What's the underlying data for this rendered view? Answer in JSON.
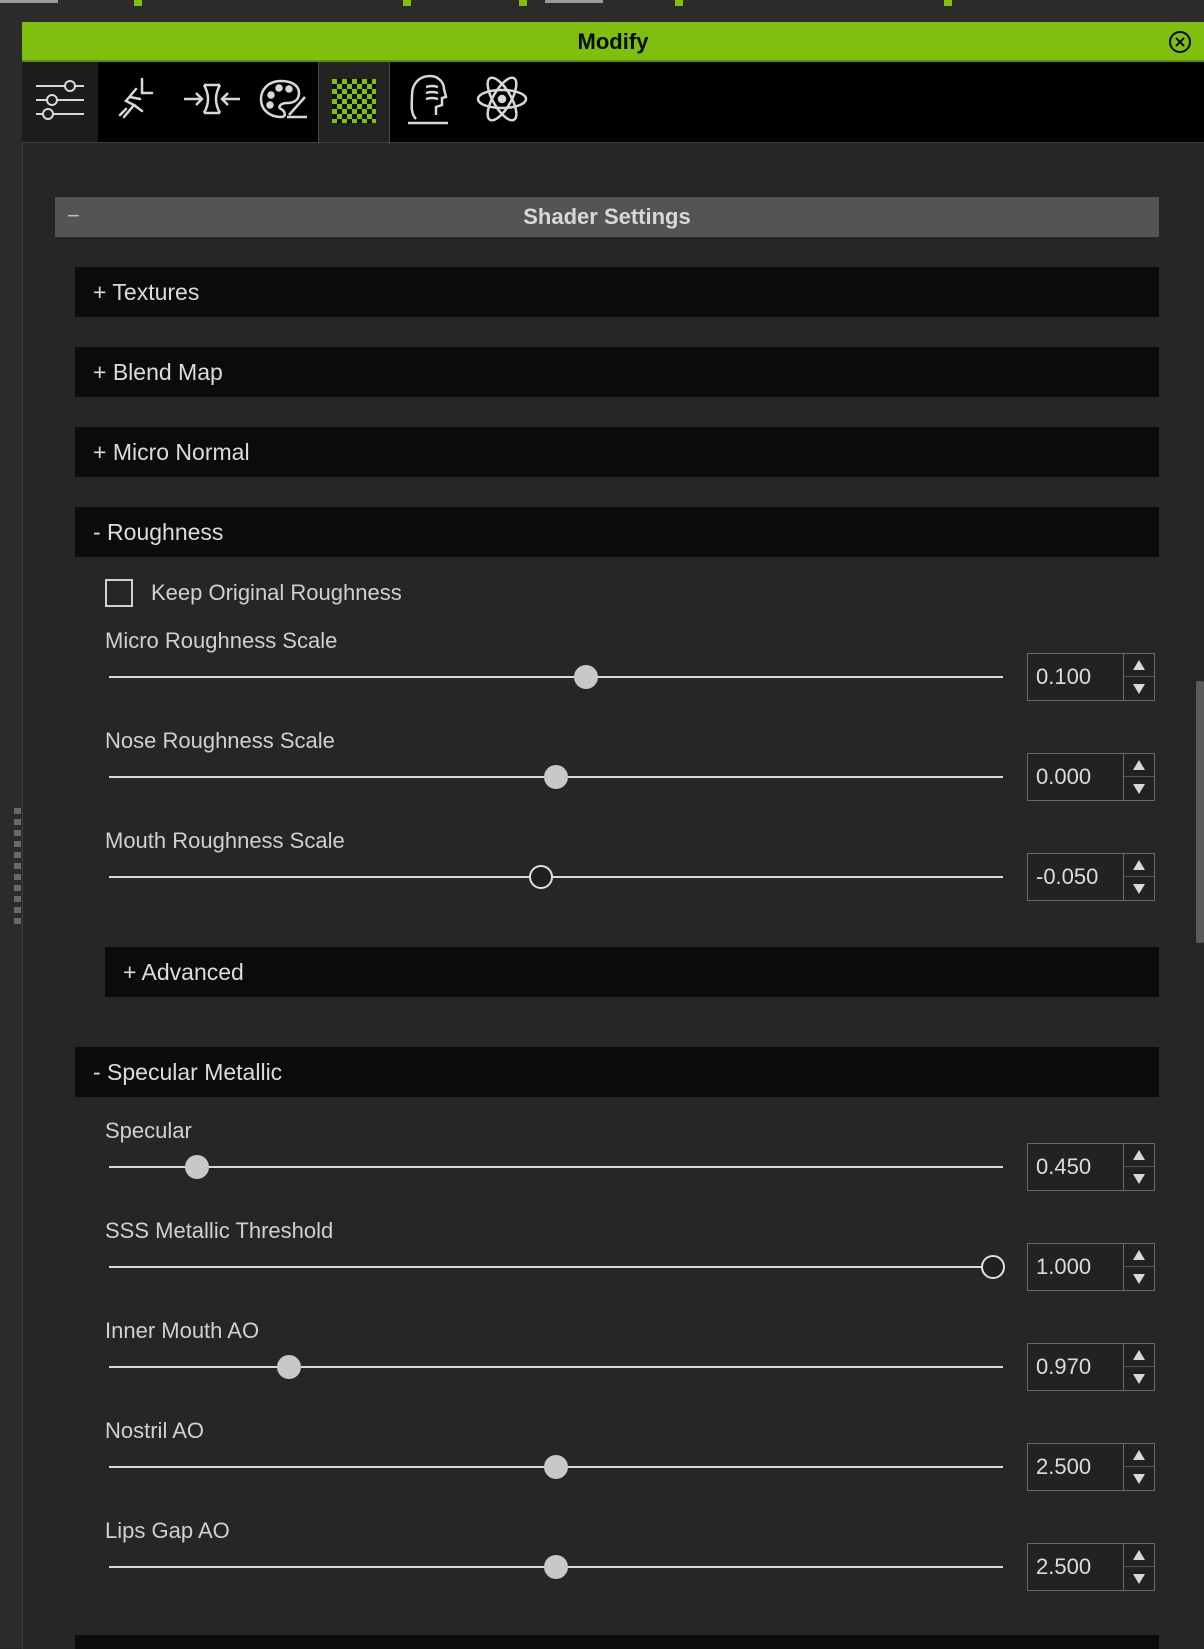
{
  "panel": {
    "title": "Modify"
  },
  "tabs": [
    {
      "icon": "sliders-icon",
      "active": false
    },
    {
      "icon": "motion-pose-icon",
      "active": false
    },
    {
      "icon": "morph-compress-icon",
      "active": false
    },
    {
      "icon": "paint-palette-icon",
      "active": false
    },
    {
      "icon": "checker-material-icon",
      "active": true
    },
    {
      "icon": "head-wrinkle-icon",
      "active": false
    },
    {
      "icon": "atom-physics-icon",
      "active": false
    }
  ],
  "shader": {
    "header": "Shader Settings",
    "collapse_symbol": "−",
    "sections": {
      "textures": "+  Textures",
      "blend_map": "+  Blend Map",
      "micro_normal": "+  Micro Normal",
      "roughness": "-  Roughness",
      "advanced": "+  Advanced",
      "specular_metallic": "-  Specular Metallic"
    },
    "keep_original": {
      "label": "Keep Original Roughness",
      "checked": false
    },
    "roughness_sliders": [
      {
        "label": "Micro Roughness Scale",
        "value": "0.100",
        "position": 0.533
      },
      {
        "label": "Nose Roughness Scale",
        "value": "0.000",
        "position": 0.5
      },
      {
        "label": "Mouth Roughness Scale",
        "value": "-0.050",
        "position": 0.483
      }
    ],
    "specular_sliders": [
      {
        "label": "Specular",
        "value": "0.450",
        "position": 0.098
      },
      {
        "label": "SSS Metallic Threshold",
        "value": "1.000",
        "position": 0.989
      },
      {
        "label": "Inner Mouth AO",
        "value": "0.970",
        "position": 0.201
      },
      {
        "label": "Nostril AO",
        "value": "2.500",
        "position": 0.5
      },
      {
        "label": "Lips Gap AO",
        "value": "2.500",
        "position": 0.5
      }
    ]
  },
  "colors": {
    "accent": "#7fbf0e",
    "section_bg": "#0b0b0b",
    "panel_bg": "#262626"
  }
}
